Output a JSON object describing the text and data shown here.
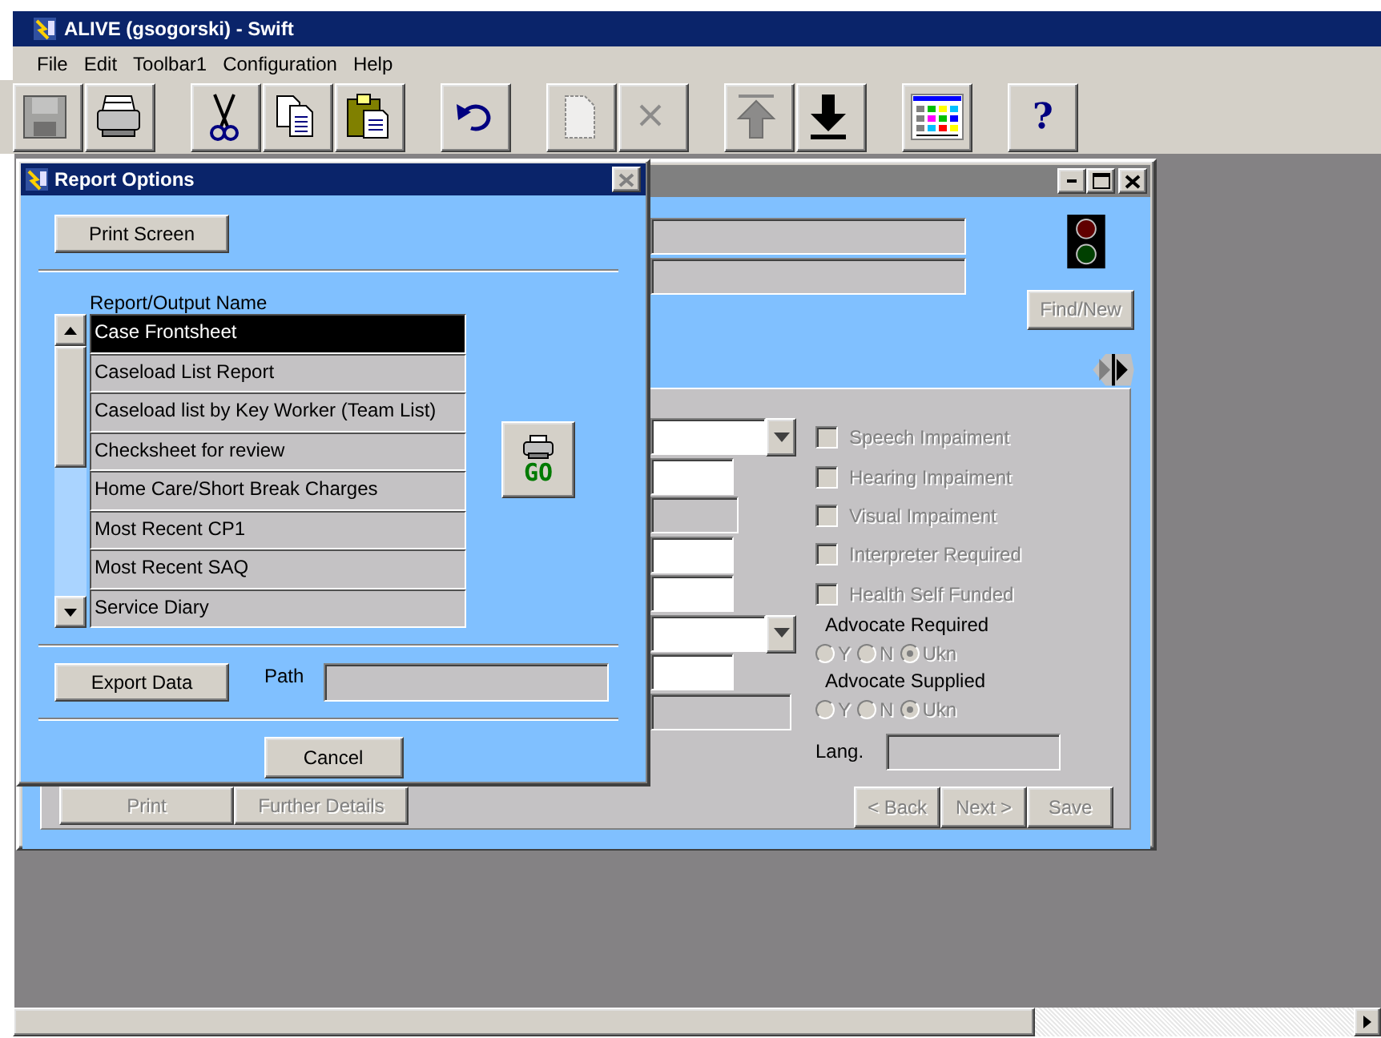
{
  "app_window": {
    "title": "ALIVE (gsogorski) - Swift"
  },
  "menu": [
    {
      "label": "File"
    },
    {
      "label": "Edit"
    },
    {
      "label": "Toolbar1"
    },
    {
      "label": "Configuration"
    },
    {
      "label": "Help"
    }
  ],
  "toolbar": [
    [
      {
        "disabled": true
      },
      {
        "disabled": false
      }
    ],
    [
      {
        "disabled": false
      },
      {
        "disabled": false
      },
      {
        "disabled": false
      }
    ],
    [
      {
        "disabled": false
      }
    ],
    [
      {
        "disabled": true
      },
      {
        "disabled": true
      }
    ],
    [
      {
        "disabled": true
      },
      {
        "disabled": false
      }
    ],
    [
      {
        "disabled": false
      }
    ],
    [
      {
        "label": "?",
        "disabled": false
      }
    ]
  ],
  "child_window": {
    "find_button": {
      "label": "Find/New",
      "disabled": true
    },
    "fields": [
      {
        "kind": "dropdown"
      },
      {
        "kind": "entry"
      },
      {
        "kind": "display"
      },
      {
        "kind": "entry"
      },
      {
        "kind": "entry"
      },
      {
        "kind": "dropdown"
      },
      {
        "kind": "entry"
      },
      {
        "kind": "display_wide"
      }
    ],
    "checkboxes": [
      {
        "label": "Speech Impaiment",
        "checked": false,
        "disabled": true
      },
      {
        "label": "Hearing Impaiment",
        "checked": false,
        "disabled": true
      },
      {
        "label": "Visual Impaiment",
        "checked": false,
        "disabled": true
      },
      {
        "label": "Interpreter Required",
        "checked": false,
        "disabled": true
      },
      {
        "label": "Health Self Funded",
        "checked": false,
        "disabled": true
      }
    ],
    "radio_groups": [
      {
        "label": "Advocate Required",
        "disabled": true,
        "options": [
          {
            "label": "Y",
            "selected": false
          },
          {
            "label": "N",
            "selected": false
          },
          {
            "label": "Ukn",
            "selected": true
          }
        ]
      },
      {
        "label": "Advocate Supplied",
        "disabled": true,
        "options": [
          {
            "label": "Y",
            "selected": false
          },
          {
            "label": "N",
            "selected": false
          },
          {
            "label": "Ukn",
            "selected": true
          }
        ]
      }
    ],
    "lang_label": "Lang.",
    "left_buttons": [
      {
        "label": "Print",
        "disabled": true
      },
      {
        "label": "Further Details",
        "disabled": true
      }
    ],
    "right_buttons": [
      {
        "label": "< Back",
        "disabled": true
      },
      {
        "label": "Next >",
        "disabled": true
      },
      {
        "label": "Save",
        "disabled": true
      }
    ]
  },
  "report_dialog": {
    "title": "Report Options",
    "print_screen": "Print Screen",
    "list_label": "Report/Output Name",
    "reports": [
      {
        "label": "Case Frontsheet",
        "selected": true
      },
      {
        "label": "Caseload List Report",
        "selected": false
      },
      {
        "label": "Caseload list by Key Worker (Team List)",
        "selected": false
      },
      {
        "label": "Checksheet for review",
        "selected": false
      },
      {
        "label": "Home Care/Short Break Charges",
        "selected": false
      },
      {
        "label": "Most Recent CP1",
        "selected": false
      },
      {
        "label": "Most Recent SAQ",
        "selected": false
      },
      {
        "label": "Service Diary",
        "selected": false
      }
    ],
    "go_label": "GO",
    "export_label": "Export Data",
    "path_label": "Path",
    "cancel_label": "Cancel"
  }
}
